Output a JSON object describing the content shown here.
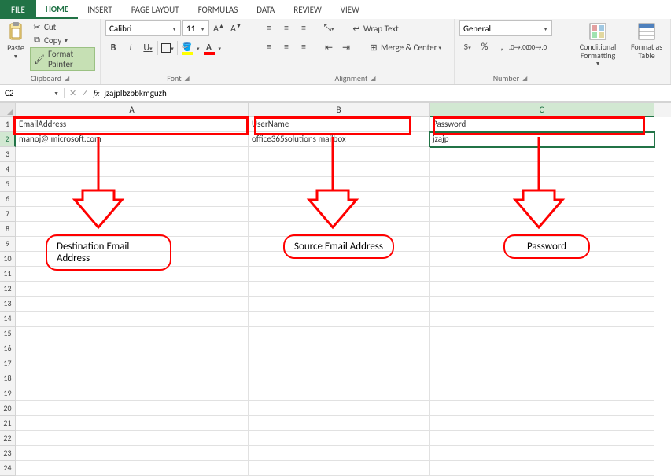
{
  "tabs": {
    "file": "FILE",
    "items": [
      "HOME",
      "INSERT",
      "PAGE LAYOUT",
      "FORMULAS",
      "DATA",
      "REVIEW",
      "VIEW"
    ],
    "active_index": 0
  },
  "ribbon": {
    "clipboard": {
      "label": "Clipboard",
      "paste": "Paste",
      "cut": "Cut",
      "copy": "Copy",
      "format_painter": "Format Painter"
    },
    "font": {
      "label": "Font",
      "family": "Calibri",
      "size": "11",
      "bold": "B",
      "italic": "I",
      "underline": "U",
      "increase_font_tooltip": "A",
      "decrease_font_tooltip": "A"
    },
    "alignment": {
      "label": "Alignment",
      "wrap": "Wrap Text",
      "merge": "Merge & Center"
    },
    "number": {
      "label": "Number",
      "format": "General"
    },
    "styles": {
      "conditional": "Conditional Formatting",
      "format_table": "Format as Table"
    }
  },
  "name_box": "C2",
  "formula_bar": "jzajplbzbbkmguzh",
  "columns": [
    "A",
    "B",
    "C"
  ],
  "rows": {
    "1": {
      "A": "EmailAddress",
      "B": "UserName",
      "C": "Password"
    },
    "2": {
      "A": "manoj@             microsoft.com",
      "B": "office365solutions mailbox",
      "C": "jzajp"
    }
  },
  "row_numbers": [
    "1",
    "2",
    "3",
    "4",
    "5",
    "6",
    "7",
    "8",
    "9",
    "10",
    "11",
    "12",
    "13",
    "14",
    "15",
    "16",
    "17",
    "18",
    "19",
    "20",
    "21",
    "22",
    "23",
    "24"
  ],
  "active_cell": "C2",
  "annotations": {
    "label_a": "Destination Email Address",
    "label_b": "Source Email Address",
    "label_c": "Password"
  }
}
